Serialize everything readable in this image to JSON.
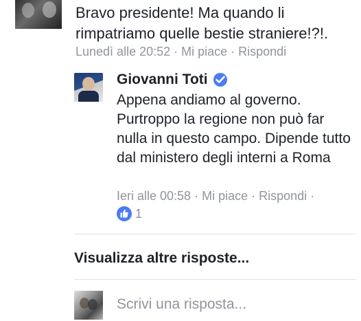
{
  "comment": {
    "text": "Bravo presidente! Ma quando li rimpatriamo quelle bestie straniere!?!.",
    "timestamp": "Lunedì alle 20:52",
    "like_label": "Mi piace",
    "reply_label": "Rispondi"
  },
  "reply": {
    "author": "Giovanni Toti",
    "verified_icon": "verified-badge-icon",
    "text": "Appena andiamo al governo. Purtroppo la regione non può far nulla in questo campo. Dipende tutto dal ministero degli interni a Roma",
    "timestamp": "Ieri alle 00:58",
    "like_label": "Mi piace",
    "reply_label": "Rispondi",
    "trailing_sep": "·",
    "like_count": "1",
    "like_icon": "thumbs-up-icon"
  },
  "separator": "·",
  "more_replies_label": "Visualizza altre risposte...",
  "reply_box": {
    "placeholder": "Scrivi una risposta..."
  },
  "colors": {
    "text": "#1d2129",
    "meta": "#90949c",
    "accent": "#4b7cf3",
    "divider": "#dddfe2"
  }
}
